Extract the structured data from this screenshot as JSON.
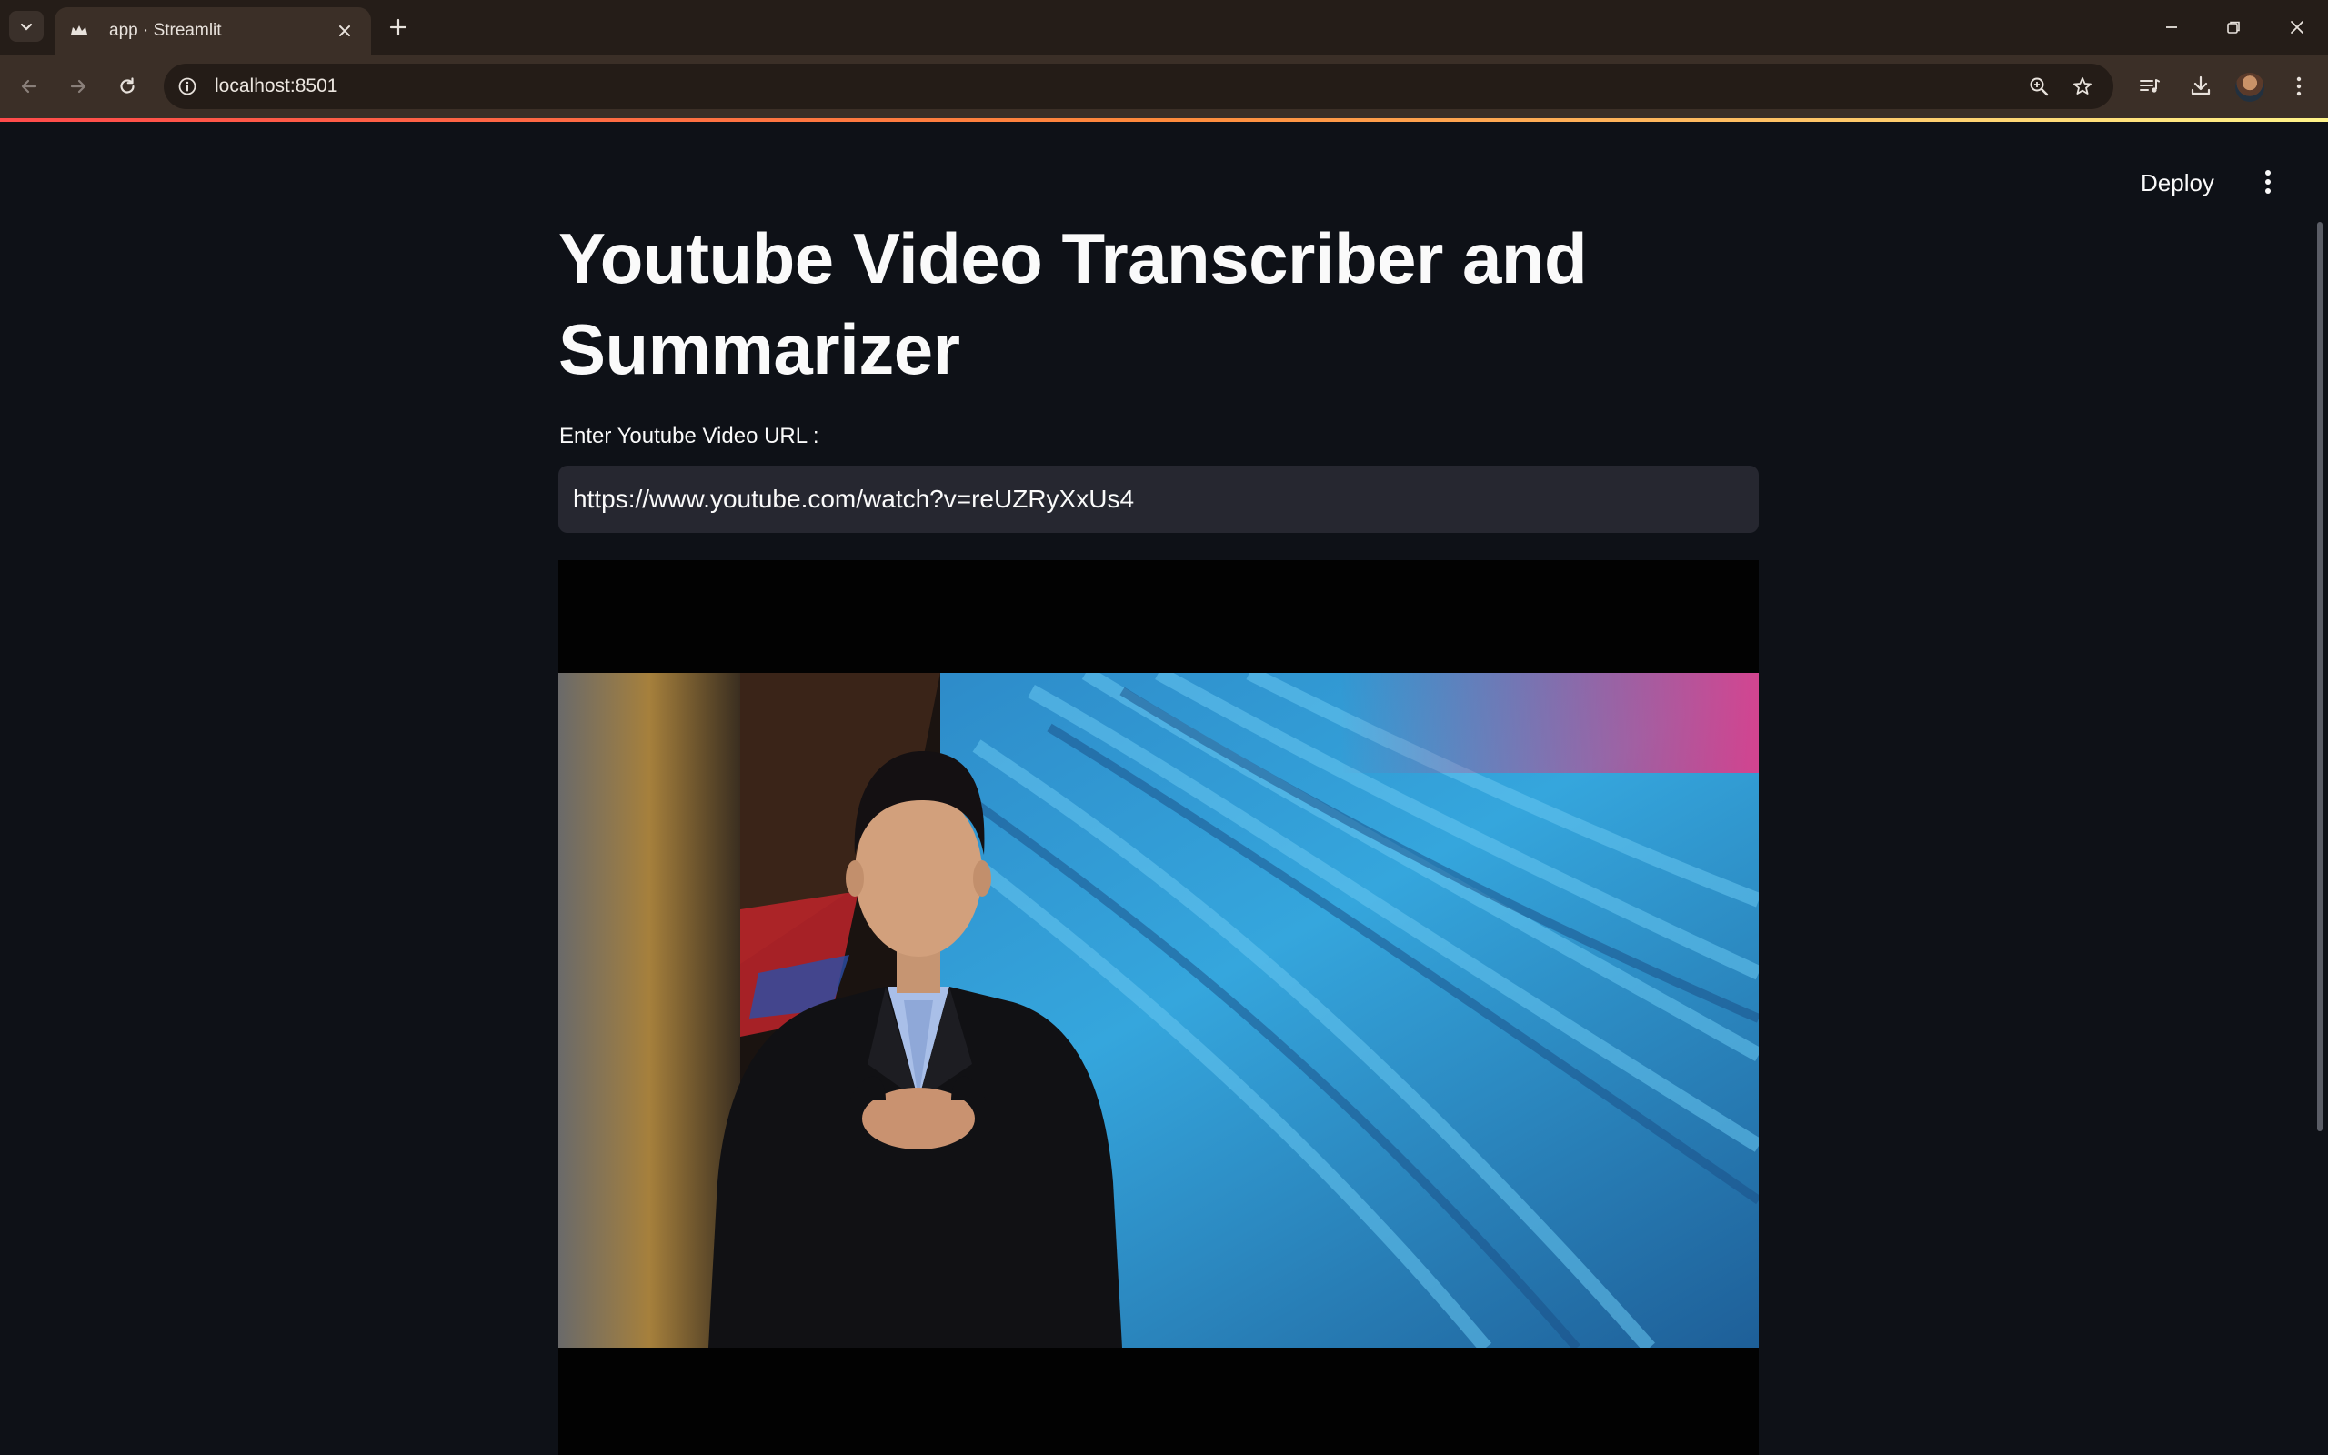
{
  "browser": {
    "tab_title": "app · Streamlit",
    "url": "localhost:8501"
  },
  "app": {
    "deploy_label": "Deploy",
    "title": "Youtube Video Transcriber and Summarizer",
    "url_input_label": "Enter Youtube Video URL :",
    "url_input_value": "https://www.youtube.com/watch?v=reUZRyXxUs4"
  },
  "colors": {
    "app_background": "#0e1117",
    "input_background": "#262730",
    "browser_frame": "#3b2f27",
    "accent_gradient": [
      "#ff4b4b",
      "#fff48a"
    ]
  },
  "icons": {
    "tab_search": "chevron-down-icon",
    "favicon": "streamlit-crown-icon",
    "tab_close": "close-icon",
    "new_tab": "plus-icon",
    "minimize": "minimize-icon",
    "restore": "restore-icon",
    "close_window": "close-icon",
    "back": "arrow-left-icon",
    "forward": "arrow-right-icon",
    "reload": "reload-icon",
    "site_info": "info-icon",
    "zoom": "zoom-icon",
    "bookmark": "star-icon",
    "media": "media-queue-icon",
    "download": "download-icon",
    "menu": "kebab-menu-icon"
  }
}
